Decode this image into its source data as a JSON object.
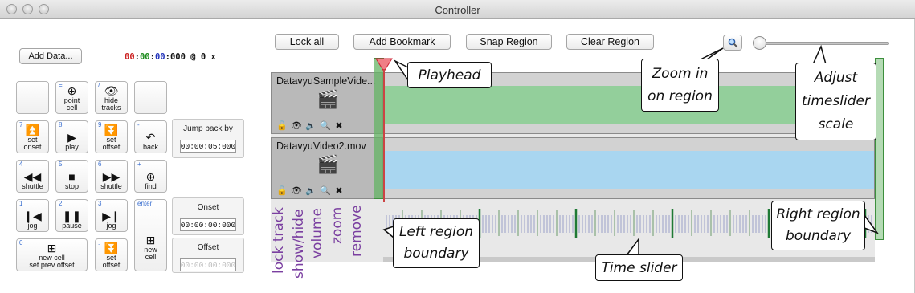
{
  "window": {
    "title": "Controller"
  },
  "toolbar": {
    "lock_all": "Lock all",
    "add_bookmark": "Add Bookmark",
    "snap_region": "Snap Region",
    "clear_region": "Clear Region",
    "zoom_icon": "magnifier-icon"
  },
  "left": {
    "add_data": "Add Data...",
    "timecode": {
      "hh": "00",
      "mm": "00",
      "ss": "00",
      "ms": "000",
      "rate": "@ 0 x"
    }
  },
  "keypad": {
    "point_cell": {
      "num": "=",
      "label": "point\ncell"
    },
    "hide_tracks": {
      "num": "/",
      "label": "hide\ntracks"
    },
    "set_onset": {
      "num": "7",
      "label": "set\nonset"
    },
    "play": {
      "num": "8",
      "label": "play"
    },
    "set_offset_top": {
      "num": "9",
      "label": "set\noffset"
    },
    "back": {
      "num": "-",
      "label": "back"
    },
    "shuttle_back": {
      "num": "4",
      "label": "shuttle"
    },
    "stop": {
      "num": "5",
      "label": "stop"
    },
    "shuttle_fwd": {
      "num": "6",
      "label": "shuttle"
    },
    "find": {
      "num": "+",
      "label": "find"
    },
    "jog_back": {
      "num": "1",
      "label": "jog"
    },
    "pause": {
      "num": "2",
      "label": "pause"
    },
    "jog_fwd": {
      "num": "3",
      "label": "jog"
    },
    "new_cell_prev": {
      "num": "0",
      "label": "new cell\nset prev offset"
    },
    "set_offset_bottom": {
      "num": ".",
      "label": "set\noffset"
    },
    "new_cell": {
      "num": "enter",
      "label": "new\ncell"
    }
  },
  "side": {
    "jump_back_label": "Jump back by",
    "jump_back_value": "00:00:05:000",
    "onset_label": "Onset",
    "onset_value": "00:00:00:000",
    "offset_label": "Offset",
    "offset_value": "00:00:00:000"
  },
  "tracks": [
    {
      "name": "DatavyuSampleVide...",
      "color": "#93cf9b"
    },
    {
      "name": "DatavyuVideo2.mov",
      "color": "#a9d6f0"
    }
  ],
  "track_icons": [
    "lock-icon",
    "eye-icon",
    "speaker-icon",
    "zoom-icon",
    "remove-icon"
  ],
  "annotations": {
    "playhead": "Playhead",
    "zoom_in": "Zoom in\non region",
    "adjust": "Adjust\ntimeslider\nscale",
    "left_region": "Left region\nboundary",
    "right_region": "Right region\nboundary",
    "time_slider": "Time slider",
    "vlabels": [
      "lock track",
      "show/hide",
      "volume",
      "zoom",
      "remove"
    ]
  },
  "colors": {
    "region": "#5fb35f",
    "playhead": "#f07f86",
    "vlabel": "#7a3fa0",
    "track1": "#93cf9b",
    "track2": "#a9d6f0"
  }
}
